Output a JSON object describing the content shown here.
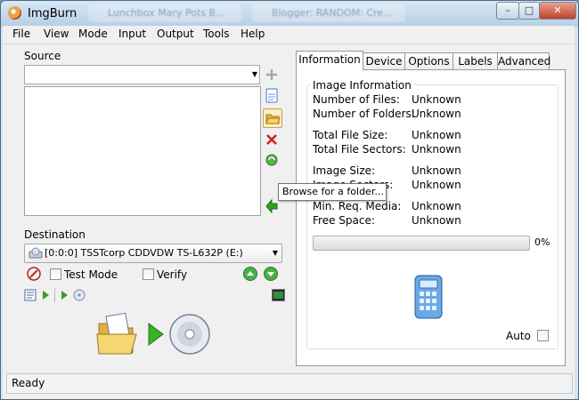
{
  "window": {
    "title": "ImgBurn",
    "background_tabs": [
      "Lunchbox Mary Pots B...",
      "Blogger: RANDOM: Cre..."
    ],
    "controls": {
      "minimize": "–",
      "maximize": "□",
      "close": "✕"
    }
  },
  "menu": [
    "File",
    "View",
    "Mode",
    "Input",
    "Output",
    "Tools",
    "Help"
  ],
  "source": {
    "label": "Source",
    "combo_value": "",
    "tooltip": "Browse for a folder..."
  },
  "destination": {
    "label": "Destination",
    "drive": "[0:0:0] TSSTcorp CDDVDW TS-L632P (E:)",
    "test_mode_label": "Test Mode",
    "verify_label": "Verify"
  },
  "tabs": [
    "Information",
    "Device",
    "Options",
    "Labels",
    "Advanced"
  ],
  "active_tab": "Information",
  "information": {
    "group_title": "Image Information",
    "rows": [
      {
        "label": "Number of Files:",
        "value": "Unknown"
      },
      {
        "label": "Number of Folders:",
        "value": "Unknown"
      },
      {
        "label": "Total File Size:",
        "value": "Unknown"
      },
      {
        "label": "Total File Sectors:",
        "value": "Unknown"
      },
      {
        "label": "Image Size:",
        "value": "Unknown"
      },
      {
        "label": "Image Sectors:",
        "value": "Unknown"
      },
      {
        "label": "Min. Req. Media:",
        "value": "Unknown"
      },
      {
        "label": "Free Space:",
        "value": "Unknown"
      }
    ],
    "progress_text": "0%",
    "progress_fraction": 0,
    "auto_label": "Auto"
  },
  "status": {
    "text": "Ready"
  },
  "icons": {
    "add": "plus-icon",
    "add_file": "file-icon",
    "browse_folder": "folder-open-icon",
    "remove": "red-x-icon",
    "refresh": "globe-refresh-icon",
    "calculate": "green-arrow-icon",
    "drive": "optical-drive-icon",
    "eject": "eject-icon",
    "calculator": "calculator-icon",
    "build": "build-icon"
  },
  "colors": {
    "accent": "#3d7fc9",
    "green": "#3a9a2a",
    "red": "#d02020"
  }
}
